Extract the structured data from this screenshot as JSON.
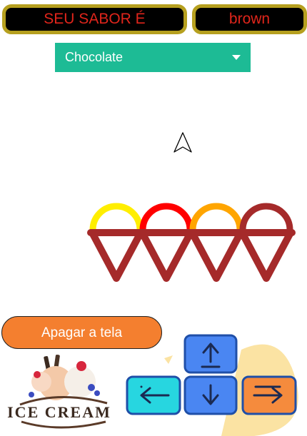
{
  "header": {
    "flavor_label": "SEU SABOR É",
    "flavor_value": "brown"
  },
  "flavor_select": {
    "selected": "Chocolate"
  },
  "canvas": {
    "scoops": [
      {
        "color": "#ffee00"
      },
      {
        "color": "#ff0000"
      },
      {
        "color": "#ffa500"
      },
      {
        "color": "#a52a2a"
      }
    ],
    "cone_color": "#a52a2a"
  },
  "controls": {
    "clear_label": "Apagar a tela",
    "keys": [
      "up",
      "left",
      "down",
      "right"
    ]
  },
  "logo": {
    "text": "ICE CREAM"
  },
  "colors": {
    "pill_border": "#b6a01f",
    "pill_text": "#e0251b",
    "select_bg": "#1dbb95",
    "button_bg": "#f47f2f",
    "key_blue": "#4a86f2",
    "key_cyan": "#27d6e0",
    "key_orange": "#f58b3d"
  }
}
